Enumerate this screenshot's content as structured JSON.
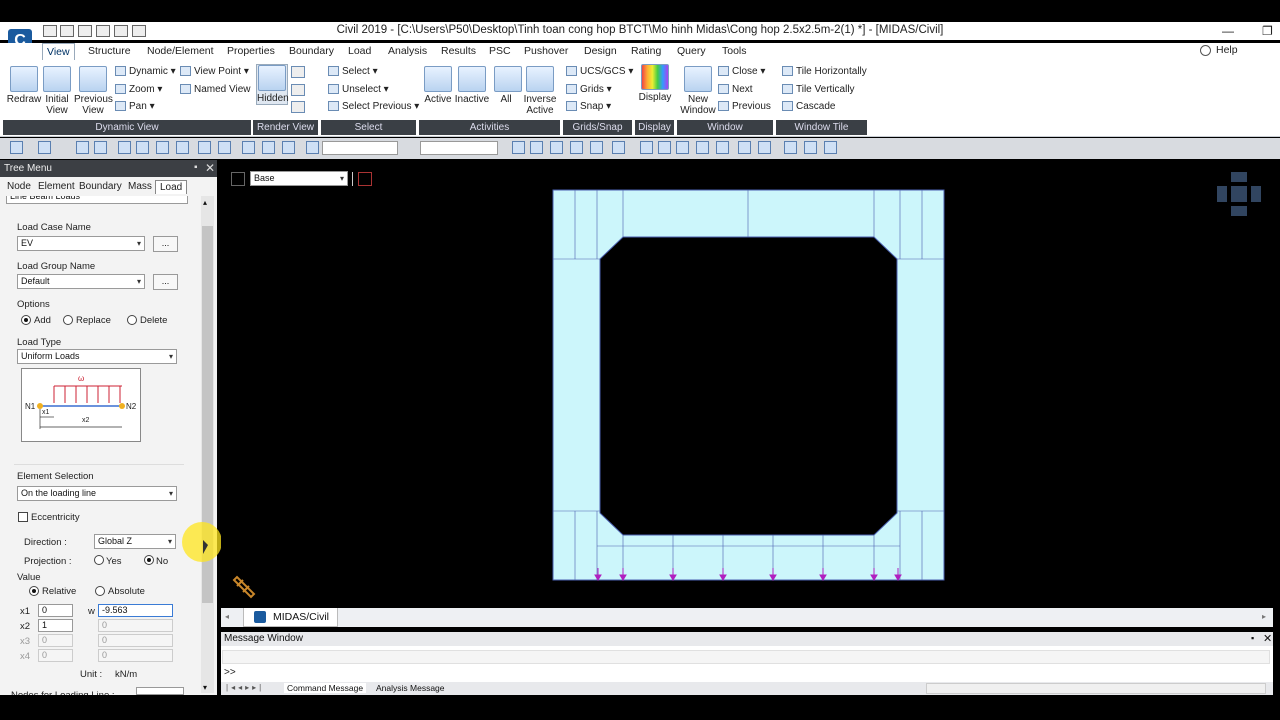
{
  "window": {
    "title": "Civil 2019 - [C:\\Users\\P50\\Desktop\\Tinh toan cong hop BTCT\\Mo hinh Midas\\Cong hop 2.5x2.5m-2(1) *] - [MIDAS/Civil]",
    "minimize": "—",
    "restore": "❐"
  },
  "menu": {
    "items": [
      "View",
      "Structure",
      "Node/Element",
      "Properties",
      "Boundary",
      "Load",
      "Analysis",
      "Results",
      "PSC",
      "Pushover",
      "Design",
      "Rating",
      "Query",
      "Tools"
    ],
    "help": "Help"
  },
  "ribbon": {
    "dynamic_view": {
      "label": "Dynamic View",
      "redraw": "Redraw",
      "initial_view": "Initial View",
      "previous_view": "Previous View",
      "dynamic": "Dynamic",
      "zoom": "Zoom",
      "pan": "Pan",
      "view_point": "View Point",
      "named_view": "Named View"
    },
    "render_view": {
      "label": "Render View",
      "hidden": "Hidden"
    },
    "select": {
      "label": "Select",
      "select": "Select",
      "unselect": "Unselect",
      "select_previous": "Select Previous"
    },
    "activities": {
      "label": "Activities",
      "active": "Active",
      "inactive": "Inactive",
      "all": "All",
      "inverse_active": "Inverse Active"
    },
    "grids_snap": {
      "label": "Grids/Snap",
      "ucs": "UCS/GCS",
      "grids": "Grids",
      "snap": "Snap"
    },
    "display": {
      "label": "Display",
      "display": "Display"
    },
    "window": {
      "label": "Window",
      "new_window": "New Window",
      "close": "Close",
      "next": "Next",
      "previous": "Previous"
    },
    "window_tile": {
      "label": "Window Tile",
      "tile_h": "Tile Horizontally",
      "tile_v": "Tile Vertically",
      "cascade": "Cascade"
    }
  },
  "tree": {
    "title": "Tree Menu",
    "tabs": [
      "Node",
      "Element",
      "Boundary",
      "Mass",
      "Load"
    ],
    "function": "Line Beam Loads",
    "load_case_label": "Load Case Name",
    "load_case": "EV",
    "load_group_label": "Load Group Name",
    "load_group": "Default",
    "dots": "...",
    "options_label": "Options",
    "opt_add": "Add",
    "opt_replace": "Replace",
    "opt_delete": "Delete",
    "load_type_label": "Load Type",
    "load_type": "Uniform Loads",
    "diagram": {
      "w": "ω",
      "n1": "N1",
      "n2": "N2",
      "x1": "x1",
      "x2": "x2"
    },
    "element_selection_label": "Element Selection",
    "element_selection": "On the loading line",
    "eccentricity": "Eccentricity",
    "direction_label": "Direction",
    "direction": "Global Z",
    "projection_label": "Projection",
    "proj_yes": "Yes",
    "proj_no": "No",
    "value_label": "Value",
    "val_relative": "Relative",
    "val_absolute": "Absolute",
    "rows": [
      {
        "x": "x1",
        "xv": "0",
        "wl": "w",
        "wv": "-9.563"
      },
      {
        "x": "x2",
        "xv": "1",
        "wl": "",
        "wv": "0"
      },
      {
        "x": "x3",
        "xv": "0",
        "wl": "",
        "wv": "0"
      },
      {
        "x": "x4",
        "xv": "0",
        "wl": "",
        "wv": "0"
      }
    ],
    "unit_label": "Unit :",
    "unit": "kN/m",
    "nodes_label": "Nodes for Loading Line :"
  },
  "canvas": {
    "view_combo": "Base",
    "doc_tab": "MIDAS/Civil"
  },
  "message": {
    "title": "Message Window",
    "prompt": ">>",
    "tabs": [
      "Command Message",
      "Analysis Message"
    ]
  },
  "colors": {
    "model_fill": "#ccf6fb",
    "model_edge": "#4a5fb0",
    "load_arrow": "#b020c0",
    "accent": "#3a7bd5"
  }
}
